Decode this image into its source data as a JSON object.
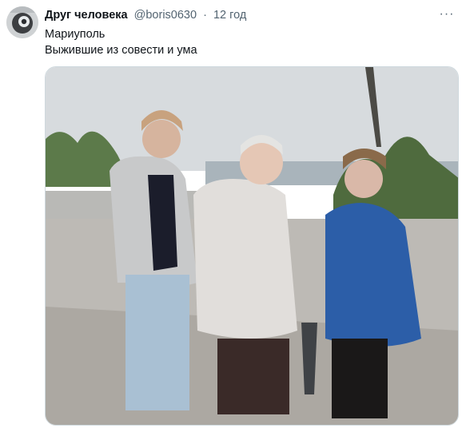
{
  "tweet": {
    "author": {
      "display_name": "Друг человека",
      "handle": "@boris0630",
      "avatar_icon": "avatar-photo"
    },
    "separator": "·",
    "timestamp": "12 год",
    "more_icon": "more-horizontal-icon",
    "more_symbol": "···",
    "text_lines": [
      "Мариуполь",
      "Выжившие из совести и ума"
    ],
    "media": {
      "kind": "photo",
      "icon": "photo-of-three-women-outdoors"
    }
  },
  "colors": {
    "name": "#0f1419",
    "secondary": "#536471",
    "border": "#cfd9de"
  }
}
